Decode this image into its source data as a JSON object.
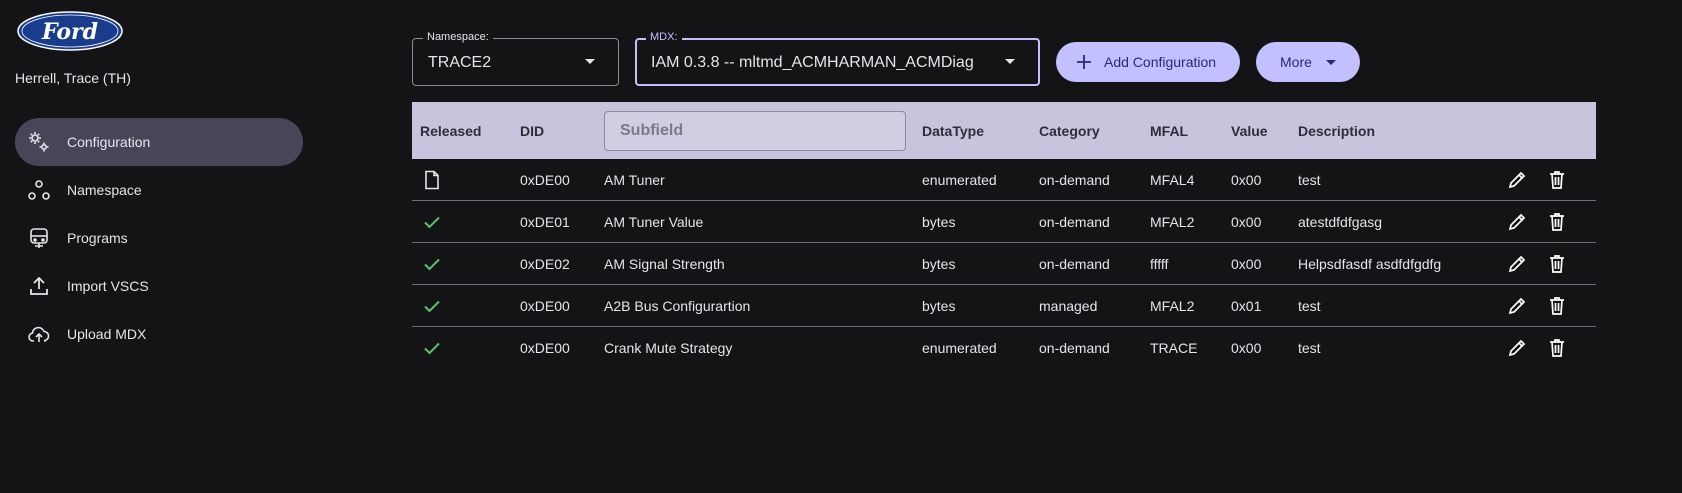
{
  "brand": {
    "logo_text": "Ford"
  },
  "user": {
    "name": "Herrell, Trace (TH)"
  },
  "sidebar": {
    "items": [
      {
        "label": "Configuration",
        "icon": "gears-icon",
        "active": true
      },
      {
        "label": "Namespace",
        "icon": "namespace-icon",
        "active": false
      },
      {
        "label": "Programs",
        "icon": "vehicle-icon",
        "active": false
      },
      {
        "label": "Import VSCS",
        "icon": "upload-icon",
        "active": false
      },
      {
        "label": "Upload MDX",
        "icon": "cloud-upload-icon",
        "active": false
      }
    ]
  },
  "toolbar": {
    "namespace": {
      "label": "Namespace:",
      "value": "TRACE2"
    },
    "mdx": {
      "label": "MDX:",
      "value": "IAM 0.3.8 -- mltmd_ACMHARMAN_ACMDiag"
    },
    "add_label": "Add Configuration",
    "more_label": "More"
  },
  "table": {
    "columns": {
      "released": "Released",
      "did": "DID",
      "subfield_placeholder": "Subfield",
      "datatype": "DataType",
      "category": "Category",
      "mfal": "MFAL",
      "value": "Value",
      "description": "Description"
    },
    "rows": [
      {
        "released": "document",
        "did": "0xDE00",
        "subfield": "AM Tuner",
        "datatype": "enumerated",
        "category": "on-demand",
        "mfal": "MFAL4",
        "value": "0x00",
        "description": "test"
      },
      {
        "released": "check",
        "did": "0xDE01",
        "subfield": "AM Tuner Value",
        "datatype": "bytes",
        "category": "on-demand",
        "mfal": "MFAL2",
        "value": "0x00",
        "description": "atestdfdfgasg"
      },
      {
        "released": "check",
        "did": "0xDE02",
        "subfield": "AM Signal Strength",
        "datatype": "bytes",
        "category": "on-demand",
        "mfal": "fffff",
        "value": "0x00",
        "description": "Helpsdfasdf asdfdfgdfg"
      },
      {
        "released": "check",
        "did": "0xDE00",
        "subfield": "A2B Bus Configurartion",
        "datatype": "bytes",
        "category": "managed",
        "mfal": "MFAL2",
        "value": "0x01",
        "description": "test"
      },
      {
        "released": "check",
        "did": "0xDE00",
        "subfield": "Crank Mute Strategy",
        "datatype": "enumerated",
        "category": "on-demand",
        "mfal": "TRACE",
        "value": "0x00",
        "description": "test"
      }
    ]
  },
  "colors": {
    "accent": "#c3c0ff",
    "check": "#5cc16a",
    "header_bg": "#c6c5dd",
    "active_nav": "#474659"
  }
}
